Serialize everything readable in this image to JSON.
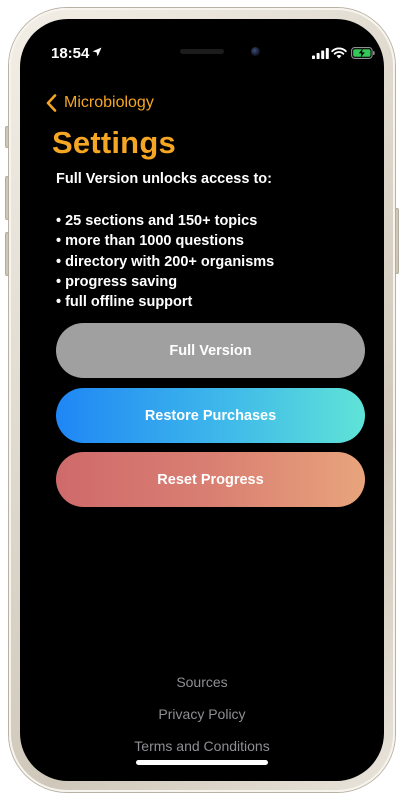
{
  "status_bar": {
    "time": "18:54"
  },
  "nav": {
    "back_label": "Microbiology"
  },
  "page": {
    "title": "Settings",
    "intro": "Full Version unlocks access to:",
    "features": [
      "• 25 sections and 150+ topics",
      "• more than 1000 questions",
      "• directory with 200+ organisms",
      "• progress saving",
      "• full offline support"
    ]
  },
  "buttons": {
    "full_version": "Full Version",
    "restore_purchases": "Restore Purchases",
    "reset_progress": "Reset Progress"
  },
  "footer": {
    "sources": "Sources",
    "privacy_policy": "Privacy Policy",
    "terms": "Terms and Conditions"
  },
  "colors": {
    "accent": "#f5a623",
    "full_version_button": "#a0a0a0",
    "restore_gradient_start": "#1f86f5",
    "restore_gradient_end": "#5fe3d7",
    "reset_gradient_start": "#cf6a6b",
    "reset_gradient_end": "#e8a47c",
    "footer_link": "#8e8e93",
    "background": "#000000",
    "battery_fill": "#34c759"
  },
  "icons": {
    "location": "location-arrow-icon",
    "signal": "cellular-signal-icon",
    "wifi": "wifi-icon",
    "battery": "battery-charging-icon",
    "back": "chevron-left-icon"
  }
}
